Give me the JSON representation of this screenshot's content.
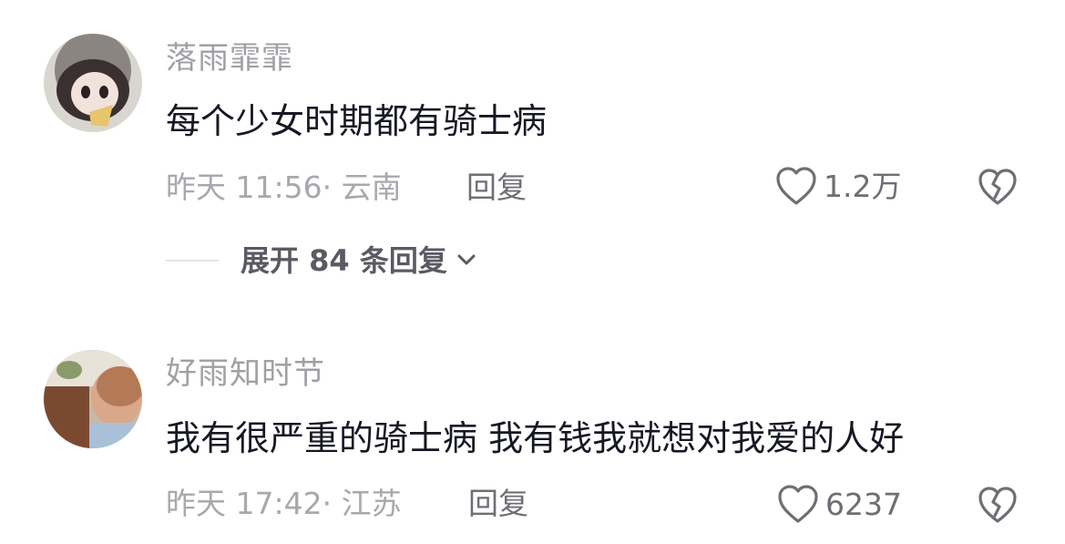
{
  "comments": [
    {
      "username": "落雨霏霏",
      "text": "每个少女时期都有骑士病",
      "meta": "昨天 11:56· 云南",
      "reply_label": "回复",
      "likes": "1.2万",
      "expand_label": "展开 84 条回复"
    },
    {
      "username": "好雨知时节",
      "text": "我有很严重的骑士病 我有钱我就想对我爱的人好",
      "meta": "昨天 17:42· 江苏",
      "reply_label": "回复",
      "likes": "6237"
    }
  ],
  "icons": {
    "like": "heart-outline-icon",
    "dislike": "broken-heart-icon",
    "expand": "chevron-down-icon"
  }
}
